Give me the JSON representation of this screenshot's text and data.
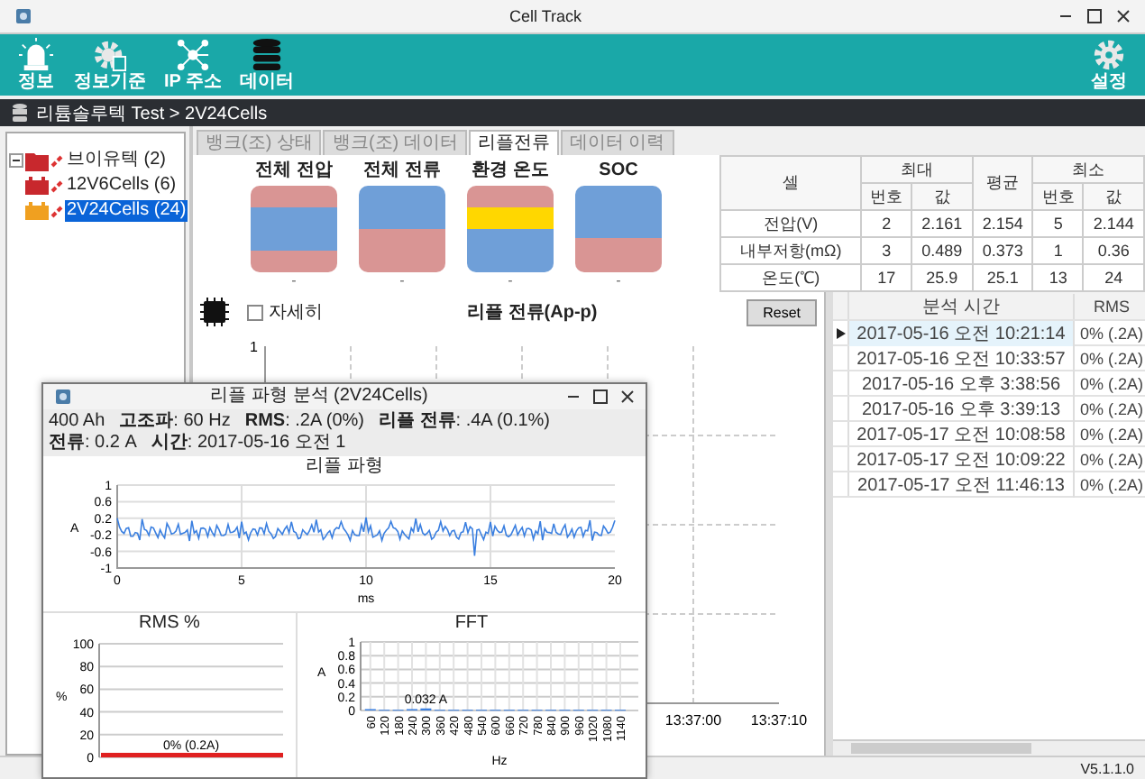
{
  "window": {
    "title": "Cell Track"
  },
  "toolbar": {
    "items": [
      {
        "label": "정보",
        "kind": "alarm"
      },
      {
        "label": "정보기준",
        "kind": "gear-doc"
      },
      {
        "label": "IP 주소",
        "kind": "network"
      },
      {
        "label": "데이터",
        "kind": "database"
      }
    ],
    "right": {
      "label": "설정",
      "kind": "gear"
    }
  },
  "breadcrumb": "리튬솔루텍 Test > 2V24Cells",
  "tree": [
    {
      "label": "브이유텍 (2)",
      "expanded": true,
      "selected": false,
      "color": "#c8282d",
      "children": [
        {
          "label": "12V6Cells (6)",
          "selected": false,
          "color": "#c8282d"
        },
        {
          "label": "2V24Cells (24)",
          "selected": true,
          "color": "#f0a020"
        }
      ]
    }
  ],
  "tabs": [
    {
      "label": "뱅크(조) 상태",
      "selected": false
    },
    {
      "label": "뱅크(조) 데이터",
      "selected": false
    },
    {
      "label": "리플전류",
      "selected": true
    },
    {
      "label": "데이터 이력",
      "selected": false
    }
  ],
  "gauges": [
    {
      "title": "전체 전압",
      "value": "-",
      "bands": [
        {
          "color": "#d99594",
          "kind": "quarter"
        },
        {
          "color": "#6f9fd8",
          "kind": "half"
        },
        {
          "color": "#d99594",
          "kind": "quarter"
        }
      ]
    },
    {
      "title": "전체 전류",
      "value": "-",
      "bands": [
        {
          "color": "#6f9fd8",
          "kind": "half"
        },
        {
          "color": "#d99594",
          "kind": "half"
        }
      ]
    },
    {
      "title": "환경 온도",
      "value": "-",
      "bands": [
        {
          "color": "#d99594",
          "kind": "quarter"
        },
        {
          "color": "#ffd700",
          "kind": "quarter"
        },
        {
          "color": "#6f9fd8",
          "kind": "half"
        }
      ]
    },
    {
      "title": "SOC",
      "value": "-",
      "bands": [
        {
          "color": "#6f9fd8",
          "kind": "major"
        },
        {
          "color": "#d99594",
          "kind": "minor"
        }
      ]
    }
  ],
  "summary_table": {
    "header_top": [
      "셀",
      "최대",
      "평균",
      "최소"
    ],
    "header_sub": [
      "번호",
      "값",
      "번호",
      "값"
    ],
    "rows": [
      [
        "전압(V)",
        "2",
        "2.161",
        "2.154",
        "5",
        "2.144"
      ],
      [
        "내부저항(mΩ)",
        "3",
        "0.489",
        "0.373",
        "1",
        "0.36"
      ],
      [
        "온도(℃)",
        "17",
        "25.9",
        "25.1",
        "13",
        "24"
      ]
    ]
  },
  "detail_checkbox": {
    "label": "자세히",
    "checked": false
  },
  "ripple_chart": {
    "title": "리플 전류(Ap-p)",
    "yticks": [
      "1"
    ],
    "xticks": [
      "13:37:00",
      "13:37:10"
    ]
  },
  "reset_button": "Reset",
  "history_grid": {
    "columns": [
      "분석 시간",
      "RMS"
    ],
    "rows": [
      {
        "time": "2017-05-16 오전 10:21:14",
        "rms": "0% (.2A)",
        "selected": true
      },
      {
        "time": "2017-05-16 오전 10:33:57",
        "rms": "0% (.2A)",
        "selected": false
      },
      {
        "time": "2017-05-16 오후 3:38:56",
        "rms": "0% (.2A)",
        "selected": false
      },
      {
        "time": "2017-05-16 오후 3:39:13",
        "rms": "0% (.2A)",
        "selected": false
      },
      {
        "time": "2017-05-17 오전 10:08:58",
        "rms": "0% (.2A)",
        "selected": false
      },
      {
        "time": "2017-05-17 오전 10:09:22",
        "rms": "0% (.2A)",
        "selected": false
      },
      {
        "time": "2017-05-17 오전 11:46:13",
        "rms": "0% (.2A)",
        "selected": false
      }
    ]
  },
  "status_bar": {
    "version": "V5.1.1.0"
  },
  "wave_window": {
    "title": "리플 파형 분석 (2V24Cells)",
    "info": [
      {
        "value": "400 Ah"
      },
      {
        "label": "고조파",
        "value": ": 60 Hz"
      },
      {
        "label": "RMS",
        "value": ": .2A (0%)"
      },
      {
        "label": "리플 전류",
        "value": ": .4A (0.1%)"
      },
      {
        "label": "전류",
        "value": ": 0.2 A"
      },
      {
        "label": "시간",
        "value": ": 2017-05-16 오전 1"
      }
    ],
    "wave_plot": {
      "title": "리플 파형",
      "ylabel": "A",
      "xlabel": "ms",
      "yticks": [
        "1",
        "0.6",
        "0.2",
        "-0.2",
        "-0.6",
        "-1"
      ],
      "xticks": [
        "0",
        "5",
        "10",
        "15",
        "20"
      ]
    },
    "rms_chart": {
      "chart_data": {
        "type": "bar",
        "title": "RMS %",
        "ylabel": "%",
        "grid": true,
        "categories": [
          null
        ],
        "series": [
          {
            "color": "#e02020",
            "values": [
              4
            ]
          }
        ],
        "ylim": [
          0,
          100
        ],
        "yticks": [
          0,
          20,
          40,
          60,
          80,
          100
        ],
        "annotations": [
          "0% (0.2A)"
        ]
      }
    },
    "fft_chart": {
      "chart_data": {
        "type": "bar",
        "title": "FFT",
        "xlabel": "Hz",
        "ylabel": "A",
        "grid": true,
        "categories": [
          "60",
          "120",
          "180",
          "240",
          "300",
          "360",
          "420",
          "480",
          "540",
          "600",
          "660",
          "720",
          "780",
          "840",
          "900",
          "960",
          "1020",
          "1080",
          "1140"
        ],
        "values": [
          0.02,
          0.01,
          0.01,
          0.02,
          0.03,
          0.01,
          0.01,
          0.01,
          0.01,
          0.01,
          0.01,
          0.01,
          0.01,
          0.01,
          0.01,
          0.01,
          0.01,
          0.01,
          0.01
        ],
        "ylim": [
          0,
          1
        ],
        "yticks": [
          0,
          0.2,
          0.4,
          0.6,
          0.8,
          1
        ],
        "annotations": [
          {
            "text": "0.032 A",
            "x": "300"
          }
        ]
      }
    }
  }
}
